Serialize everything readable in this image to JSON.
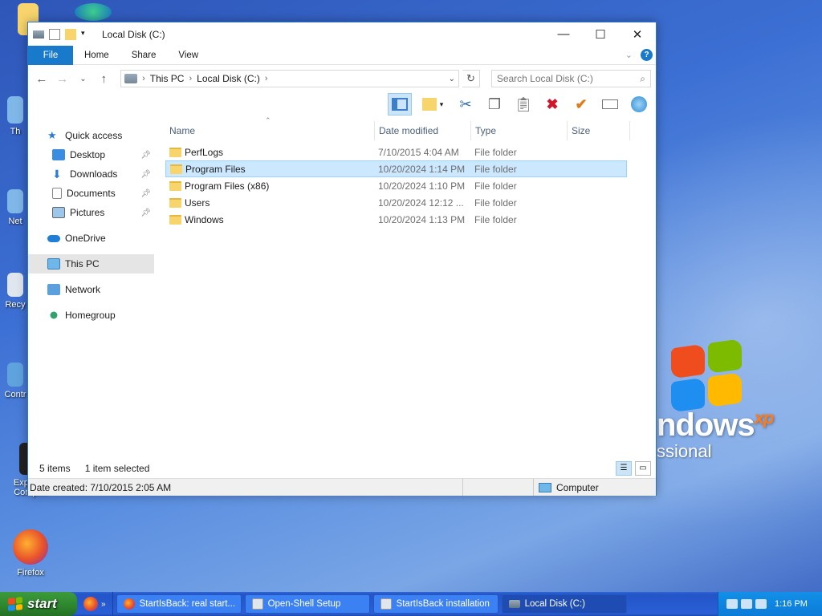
{
  "window": {
    "title": "Local Disk (C:)",
    "controls": {
      "minimize": "—",
      "maximize": "☐",
      "close": "✕"
    }
  },
  "ribbon": {
    "tabs": [
      "File",
      "Home",
      "Share",
      "View"
    ],
    "help": "?"
  },
  "address": {
    "crumbs": [
      "This PC",
      "Local Disk (C:)"
    ],
    "search_placeholder": "Search Local Disk (C:)"
  },
  "nav_pane": {
    "items": [
      {
        "label": "Quick access",
        "icon": "star-icon",
        "level": 0
      },
      {
        "label": "Desktop",
        "icon": "desktop-icon",
        "level": 1,
        "pinned": true
      },
      {
        "label": "Downloads",
        "icon": "download-arrow-icon",
        "level": 1,
        "pinned": true
      },
      {
        "label": "Documents",
        "icon": "documents-icon",
        "level": 1,
        "pinned": true
      },
      {
        "label": "Pictures",
        "icon": "pictures-icon",
        "level": 1,
        "pinned": true
      },
      {
        "label": "OneDrive",
        "icon": "cloud-icon",
        "level": 0
      },
      {
        "label": "This PC",
        "icon": "computer-icon",
        "level": 0,
        "selected": true
      },
      {
        "label": "Network",
        "icon": "network-icon",
        "level": 0
      },
      {
        "label": "Homegroup",
        "icon": "homegroup-icon",
        "level": 0
      }
    ]
  },
  "columns": [
    "Name",
    "Date modified",
    "Type",
    "Size"
  ],
  "files": [
    {
      "name": "PerfLogs",
      "modified": "7/10/2015 4:04 AM",
      "type": "File folder",
      "size": ""
    },
    {
      "name": "Program Files",
      "modified": "10/20/2024 1:14 PM",
      "type": "File folder",
      "size": "",
      "selected": true
    },
    {
      "name": "Program Files (x86)",
      "modified": "10/20/2024 1:10 PM",
      "type": "File folder",
      "size": ""
    },
    {
      "name": "Users",
      "modified": "10/20/2024 12:12 ...",
      "type": "File folder",
      "size": ""
    },
    {
      "name": "Windows",
      "modified": "10/20/2024 1:13 PM",
      "type": "File folder",
      "size": ""
    }
  ],
  "status": {
    "count": "5 items",
    "selected": "1 item selected",
    "date_created": "Date created: 7/10/2015 2:05 AM",
    "location": "Computer"
  },
  "desktop": {
    "brand": "ndows",
    "brand_sup": "xp",
    "brand_sub": "ssional",
    "icons": [
      "Th",
      "Net",
      "Recy",
      "Contr",
      "Expl File Compr...",
      "Firefox"
    ]
  },
  "taskbar": {
    "start": "start",
    "tasks": [
      {
        "label": "StartIsBack: real start...",
        "icon": "firefox-icon"
      },
      {
        "label": "Open-Shell Setup",
        "icon": "setup-icon"
      },
      {
        "label": "StartIsBack installation",
        "icon": "installer-icon"
      },
      {
        "label": "Local Disk (C:)",
        "icon": "drive-icon",
        "active": true
      }
    ],
    "clock": "1:16 PM"
  },
  "colors": {
    "accent": "#1979ca",
    "selection": "#cce8ff",
    "taskbar": "#2a5fd6",
    "start": "#2f8a2f"
  }
}
